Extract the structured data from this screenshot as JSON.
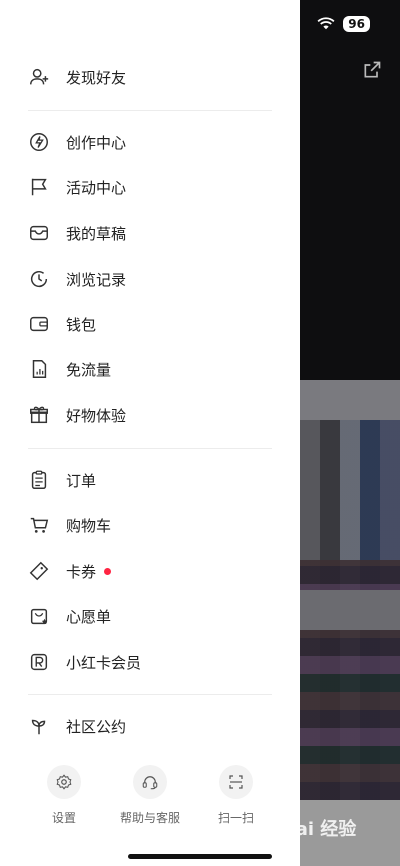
{
  "status": {
    "battery": "96"
  },
  "menu": {
    "discover_friends": "发现好友",
    "creation_center": "创作中心",
    "activity_center": "活动中心",
    "drafts": "我的草稿",
    "history": "浏览记录",
    "wallet": "钱包",
    "free_data": "免流量",
    "product_experience": "好物体验",
    "orders": "订单",
    "cart": "购物车",
    "coupons": "卡券",
    "wishlist": "心愿单",
    "redcard_member": "小红卡会员",
    "community_rules": "社区公约"
  },
  "bottom": {
    "settings": "设置",
    "help": "帮助与客服",
    "scan": "扫一扫"
  },
  "watermark": "Bai 经验"
}
